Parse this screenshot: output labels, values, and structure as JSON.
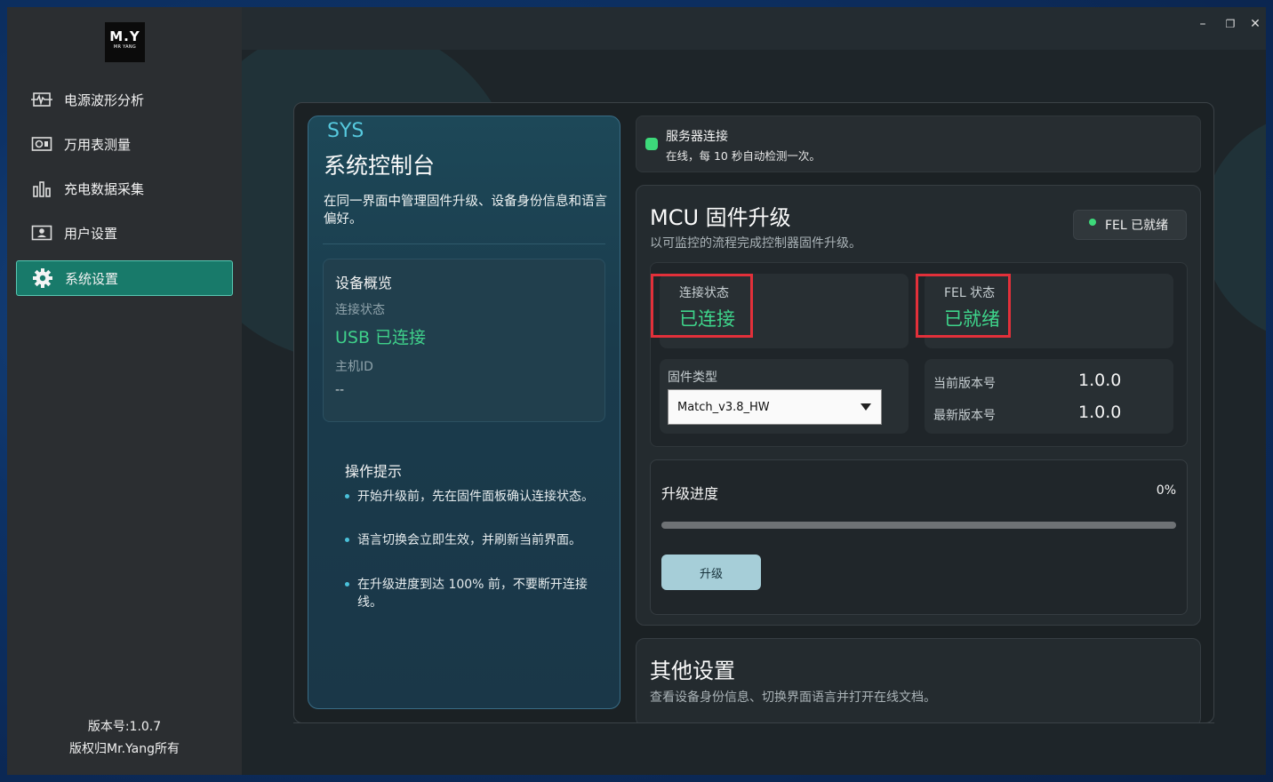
{
  "sidebar": {
    "logo": {
      "big": "M.Y",
      "small": "MR YANG"
    },
    "items": [
      {
        "label": "电源波形分析",
        "icon": "waveform-icon"
      },
      {
        "label": "万用表测量",
        "icon": "multimeter-icon"
      },
      {
        "label": "充电数据采集",
        "icon": "bar-chart-icon"
      },
      {
        "label": "用户设置",
        "icon": "user-card-icon"
      },
      {
        "label": "系统设置",
        "icon": "gear-icon",
        "active": true
      }
    ],
    "version": "版本号:1.0.7",
    "copyright": "版权归Mr.Yang所有"
  },
  "window_controls": {
    "minimize": "–",
    "maximize": "❐",
    "close": "✕"
  },
  "left_panel": {
    "tag": "SYS",
    "title": "系统控制台",
    "description": "在同一界面中管理固件升级、设备身份信息和语言偏好。",
    "device": {
      "title": "设备概览",
      "conn_label": "连接状态",
      "conn_value": "USB 已连接",
      "host_label": "主机ID",
      "host_value": "--"
    },
    "tips_title": "操作提示",
    "tips": [
      "开始升级前，先在固件面板确认连接状态。",
      "语言切换会立即生效，并刷新当前界面。",
      "在升级进度到达 100% 前，不要断开连接线。"
    ]
  },
  "server": {
    "title": "服务器连接",
    "subtitle": "在线，每 10 秒自动检测一次。",
    "status_color": "#3dd97a"
  },
  "mcu": {
    "title": "MCU 固件升级",
    "subtitle": "以可监控的流程完成控制器固件升级。",
    "badge": "FEL 已就绪",
    "conn_label": "连接状态",
    "conn_value": "已连接",
    "fel_label": "FEL 状态",
    "fel_value": "已就绪",
    "fw_type_label": "固件类型",
    "fw_type_value": "Match_v3.8_HW",
    "current_ver_label": "当前版本号",
    "current_ver_value": "1.0.0",
    "latest_ver_label": "最新版本号",
    "latest_ver_value": "1.0.0",
    "progress_label": "升级进度",
    "progress_text": "0%",
    "progress_value": 0,
    "upgrade_button": "升级"
  },
  "other": {
    "title": "其他设置",
    "subtitle": "查看设备身份信息、切换界面语言并打开在线文档。"
  },
  "colors": {
    "accent": "#187a6a",
    "success": "#3ed58b",
    "highlight": "#e2303a"
  }
}
